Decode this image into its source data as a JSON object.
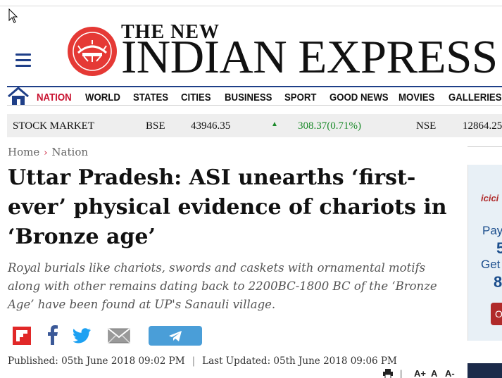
{
  "header": {
    "masthead_small": "THE NEW",
    "masthead_big": "INDIAN EXPRESS"
  },
  "nav": {
    "items": [
      {
        "label": "NATION",
        "active": true
      },
      {
        "label": "WORLD"
      },
      {
        "label": "STATES"
      },
      {
        "label": "CITIES"
      },
      {
        "label": "BUSINESS"
      },
      {
        "label": "SPORT"
      },
      {
        "label": "GOOD NEWS"
      },
      {
        "label": "MOVIES"
      },
      {
        "label": "GALLERIES"
      }
    ]
  },
  "stock": {
    "label": "STOCK MARKET",
    "bse_label": "BSE",
    "bse_value": "43946.35",
    "bse_change": "308.37(0.71%)",
    "nse_label": "NSE",
    "nse_value": "12864.25"
  },
  "breadcrumb": {
    "home": "Home",
    "separator": "›",
    "section": "Nation"
  },
  "article": {
    "headline": "Uttar Pradesh: ASI unearths ‘first-ever’ physical evidence of chariots in ‘Bronze age’",
    "summary": "Royal burials like chariots, swords and caskets with ornamental motifs along with other remains dating back to 2200BC-1800 BC of the ‘Bronze Age’ have been found at UP's Sanauli village.",
    "published": "Published: 05th June 2018 09:02 PM",
    "separator": "|",
    "updated": "Last Updated: 05th June 2018 09:06 PM"
  },
  "share": {
    "icons": [
      "flipboard-icon",
      "facebook-icon",
      "twitter-icon",
      "email-icon",
      "telegram-icon"
    ]
  },
  "tools": {
    "print_icon": "print-icon",
    "separator": "|",
    "font_increase": "A+",
    "font_reset": "A",
    "font_decrease": "A-"
  },
  "ad": {
    "brand": "icici",
    "line1": "Pay",
    "line2": "5",
    "line3": "Get",
    "line4": "8",
    "cta": "O"
  },
  "colors": {
    "brand_blue": "#1f3f88",
    "active_red": "#c8102e",
    "stock_green": "#1b8a2a",
    "twitter_blue": "#1da1f2",
    "facebook_blue": "#3b5998",
    "telegram_blue": "#4a9ed8"
  }
}
